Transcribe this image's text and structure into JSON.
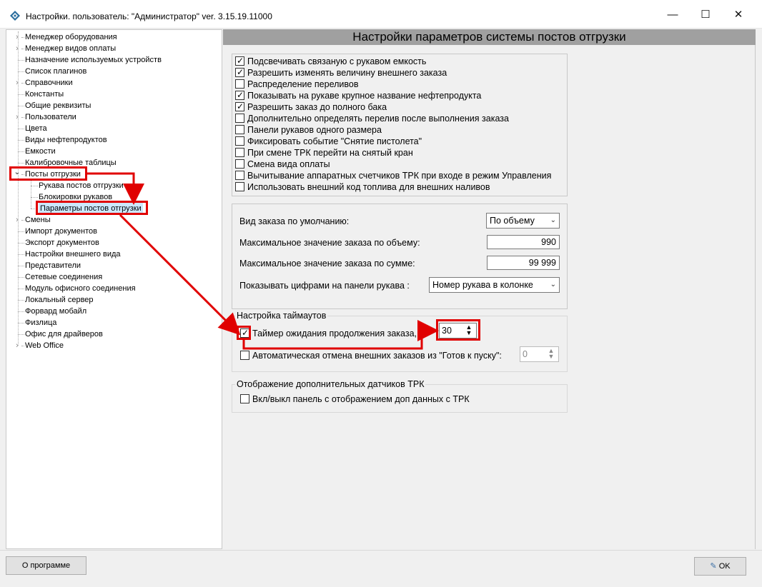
{
  "window": {
    "title": "Настройки. пользователь: \"Администратор\" ver. 3.15.19.11000",
    "minimize": "—",
    "maximize": "☐",
    "close": "✕"
  },
  "tree": [
    {
      "label": "Менеджер оборудования",
      "expandable": true
    },
    {
      "label": "Менеджер видов оплаты",
      "expandable": true
    },
    {
      "label": "Назначение используемых устройств",
      "expandable": false
    },
    {
      "label": "Список плагинов",
      "expandable": false
    },
    {
      "label": "Справочники",
      "expandable": true
    },
    {
      "label": "Константы",
      "expandable": false
    },
    {
      "label": "Общие реквизиты",
      "expandable": false
    },
    {
      "label": "Пользователи",
      "expandable": true
    },
    {
      "label": "Цвета",
      "expandable": false
    },
    {
      "label": "Виды нефтепродуктов",
      "expandable": false
    },
    {
      "label": "Емкости",
      "expandable": false
    },
    {
      "label": "Калибровочные таблицы",
      "expandable": false
    },
    {
      "label": "Посты отгрузки",
      "expandable": true,
      "expanded": true
    },
    {
      "label": "Рукава постов отгрузки",
      "child": true
    },
    {
      "label": "Блокировки рукавов",
      "child": true
    },
    {
      "label": "Параметры постов отгрузки",
      "child": true,
      "selected": true
    },
    {
      "label": "Смены",
      "expandable": true
    },
    {
      "label": "Импорт документов",
      "expandable": false
    },
    {
      "label": "Экспорт документов",
      "expandable": false
    },
    {
      "label": "Настройки внешнего вида",
      "expandable": false
    },
    {
      "label": "Представители",
      "expandable": false
    },
    {
      "label": "Сетевые соединения",
      "expandable": false
    },
    {
      "label": "Модуль офисного соединения",
      "expandable": false
    },
    {
      "label": "Локальный сервер",
      "expandable": false
    },
    {
      "label": "Форвард мобайл",
      "expandable": false
    },
    {
      "label": "Физлица",
      "expandable": false
    },
    {
      "label": "Офис для драйверов",
      "expandable": false
    },
    {
      "label": "Web Office",
      "expandable": true
    }
  ],
  "main": {
    "header": "Настройки параметров системы постов отгрузки",
    "checkboxes": [
      {
        "label": "Подсвечивать связаную с рукавом емкость",
        "checked": true
      },
      {
        "label": "Разрешить изменять величину внешнего заказа",
        "checked": true
      },
      {
        "label": "Распределение переливов",
        "checked": false
      },
      {
        "label": "Показывать на рукаве крупное название нефтепродукта",
        "checked": true
      },
      {
        "label": "Разрешить заказ до полного бака",
        "checked": true
      },
      {
        "label": "Дополнительно определять перелив после выполнения заказа",
        "checked": false
      },
      {
        "label": "Панели рукавов одного размера",
        "checked": false
      },
      {
        "label": "Фиксировать событие \"Снятие пистолета\"",
        "checked": false
      },
      {
        "label": "При смене ТРК перейти на снятый кран",
        "checked": false
      },
      {
        "label": "Смена вида оплаты",
        "checked": false
      },
      {
        "label": "Вычитывание аппаратных счетчиков ТРК при входе в режим Управления",
        "checked": false
      },
      {
        "label": "Использовать внешний код топлива для внешних наливов",
        "checked": false
      }
    ],
    "order": {
      "default_type_label": "Вид заказа по умолчанию:",
      "default_type_value": "По объему",
      "max_volume_label": "Максимальное значение заказа по объему:",
      "max_volume_value": "990",
      "max_sum_label": "Максимальное значение заказа по сумме:",
      "max_sum_value": "99 999",
      "show_digits_label": "Показывать цифрами на панели рукава :",
      "show_digits_value": "Номер рукава в колонке"
    },
    "timeouts": {
      "title": "Настройка таймаутов",
      "timer_label": "Таймер ожидания продолжения заказа, с:",
      "timer_checked": true,
      "timer_value": "30",
      "auto_cancel_label": "Автоматическая отмена внешних заказов из \"Готов к пуску\":",
      "auto_cancel_checked": false,
      "auto_cancel_value": "0"
    },
    "sensors": {
      "title": "Отображение дополнительных датчиков ТРК",
      "toggle_label": "Вкл/выкл панель с отображением доп данных с ТРК",
      "toggle_checked": false
    }
  },
  "footer": {
    "about_label": "О программе",
    "ok_label": "OK"
  },
  "colors": {
    "highlight": "#e00000",
    "header_bg": "#a0a0a0",
    "selection": "#cce8ff"
  }
}
